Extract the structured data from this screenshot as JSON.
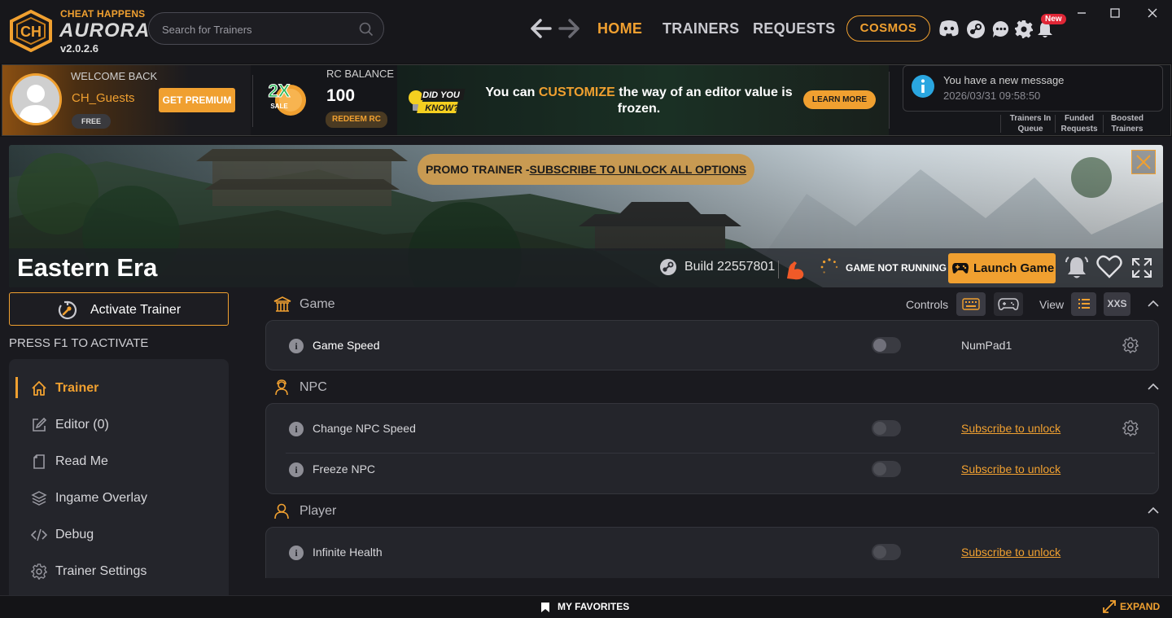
{
  "app": {
    "brand_top": "CHEAT HAPPENS",
    "brand_name": "AURORA",
    "version": "v2.0.2.6"
  },
  "search": {
    "placeholder": "Search for Trainers"
  },
  "nav": {
    "home": "HOME",
    "trainers": "TRAINERS",
    "requests": "REQUESTS",
    "cosmos": "COSMOS",
    "new_badge": "New"
  },
  "user": {
    "welcome_label": "WELCOME BACK",
    "username": "CH_Guests",
    "tier": "FREE",
    "get_premium": "GET PREMIUM"
  },
  "sale": {
    "multiplier": "2X",
    "label": "SALE"
  },
  "rc": {
    "label": "RC BALANCE",
    "value": "100",
    "redeem": "REDEEM RC"
  },
  "tip": {
    "badge_line1": "DID YOU",
    "badge_line2": "KNOW?",
    "prefix": "You can ",
    "highlight": "CUSTOMIZE",
    "suffix": " the way of an editor value is frozen.",
    "learn_more": "LEARN MORE"
  },
  "message": {
    "line1": "You have a new message",
    "line2": "2026/03/31 09:58:50"
  },
  "queue": [
    {
      "line1": "Trainers In",
      "line2": "Queue"
    },
    {
      "line1": "Funded",
      "line2": "Requests"
    },
    {
      "line1": "Boosted",
      "line2": "Trainers"
    }
  ],
  "banner": {
    "promo_prefix": "PROMO TRAINER -",
    "promo_link": "SUBSCRIBE TO UNLOCK ALL OPTIONS"
  },
  "game": {
    "title": "Eastern Era",
    "build": "Build 22557801",
    "status": "GAME NOT RUNNING",
    "launch": "Launch Game"
  },
  "sidebar": {
    "activate": "Activate Trainer",
    "press_hint": "PRESS F1 TO ACTIVATE",
    "items": [
      {
        "label": "Trainer",
        "icon": "home-icon"
      },
      {
        "label": "Editor (0)",
        "icon": "edit-icon"
      },
      {
        "label": "Read Me",
        "icon": "document-icon"
      },
      {
        "label": "Ingame Overlay",
        "icon": "layers-icon"
      },
      {
        "label": "Debug",
        "icon": "code-icon"
      },
      {
        "label": "Trainer Settings",
        "icon": "gear-icon"
      }
    ]
  },
  "toolbar": {
    "controls_label": "Controls",
    "view_label": "View",
    "xxs": "XXS"
  },
  "sections": [
    {
      "title": "Game",
      "icon": "temple-icon",
      "options": [
        {
          "label": "Game Speed",
          "key": "NumPad1",
          "locked": false
        }
      ]
    },
    {
      "title": "NPC",
      "icon": "npc-icon",
      "options": [
        {
          "label": "Change NPC Speed",
          "key": "Subscribe to unlock",
          "locked": true
        },
        {
          "label": "Freeze NPC",
          "key": "Subscribe to unlock",
          "locked": true
        }
      ]
    },
    {
      "title": "Player",
      "icon": "user-icon",
      "options": [
        {
          "label": "Infinite Health",
          "key": "Subscribe to unlock",
          "locked": true
        }
      ]
    }
  ],
  "bottom": {
    "favorites": "MY FAVORITES",
    "expand": "EXPAND"
  },
  "colors": {
    "accent": "#f0a030",
    "background": "#1a1a1f",
    "card": "#24252b",
    "badge_red": "#e02636"
  }
}
